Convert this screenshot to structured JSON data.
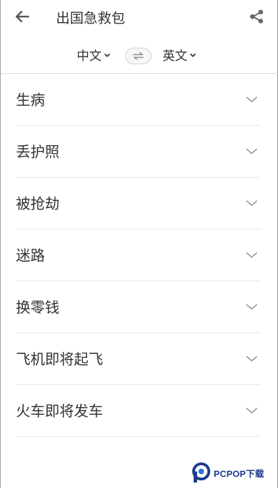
{
  "header": {
    "title": "出国急救包",
    "back_icon": "arrow-left-icon",
    "share_icon": "share-icon"
  },
  "language": {
    "from": "中文",
    "to": "英文",
    "swap_icon": "swap-arrows-icon"
  },
  "categories": [
    {
      "label": "生病"
    },
    {
      "label": "丢护照"
    },
    {
      "label": "被抢劫"
    },
    {
      "label": "迷路"
    },
    {
      "label": "换零钱"
    },
    {
      "label": "飞机即将起飞"
    },
    {
      "label": "火车即将发车"
    }
  ],
  "watermark": {
    "text": "PCPOP下载",
    "color": "#1a3a8c"
  },
  "colors": {
    "text": "#333333",
    "icon": "#555555",
    "divider": "#e6e6e6"
  }
}
